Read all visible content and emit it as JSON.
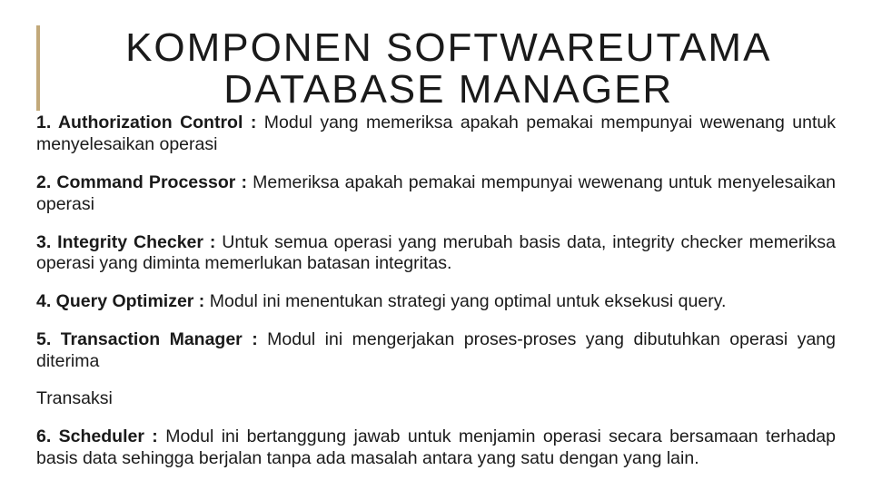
{
  "title_line1": "KOMPONEN SOFTWAREUTAMA",
  "title_line2": "DATABASE MANAGER",
  "items": [
    {
      "lead": "1. Authorization Control :",
      "text": " Modul yang memeriksa apakah pemakai mempunyai wewenang untuk  menyelesaikan operasi"
    },
    {
      "lead": "2. Command Processor :",
      "text": " Memeriksa apakah pemakai mempunyai wewenang untuk menyelesaikan operasi"
    },
    {
      "lead": "3. Integrity Checker :",
      "text": " Untuk semua operasi yang merubah basis data, integrity checker memeriksa  operasi yang diminta memerlukan batasan integritas."
    },
    {
      "lead": "4. Query Optimizer :",
      "text": " Modul ini menentukan strategi yang optimal untuk eksekusi query."
    },
    {
      "lead": "5. Transaction Manager :",
      "text": " Modul ini mengerjakan proses-proses yang dibutuhkan operasi yang diterima"
    }
  ],
  "standalone": "Transaksi",
  "item6": {
    "lead": "6. Scheduler :",
    "text": " Modul ini bertanggung jawab untuk menjamin operasi secara bersamaan terhadap basis data sehingga berjalan tanpa ada masalah antara yang satu dengan yang lain."
  }
}
